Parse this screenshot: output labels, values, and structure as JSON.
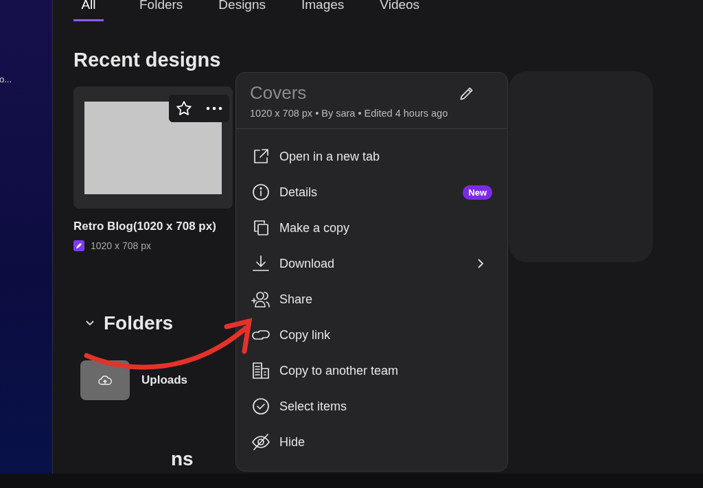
{
  "sidebar": {
    "items": [
      {
        "label": "o..."
      }
    ]
  },
  "tabs": [
    {
      "label": "All",
      "selected": true
    },
    {
      "label": "Folders",
      "selected": false
    },
    {
      "label": "Designs",
      "selected": false
    },
    {
      "label": "Images",
      "selected": false
    },
    {
      "label": "Videos",
      "selected": false
    }
  ],
  "recent": {
    "title": "Recent designs",
    "designs": [
      {
        "title": "Retro Blog(1020 x 708 px)",
        "size": "1020 x 708 px"
      }
    ]
  },
  "folders": {
    "title": "Folders",
    "expanded": true,
    "items": [
      {
        "name": "Uploads"
      }
    ]
  },
  "next_section": {
    "title": "ns"
  },
  "context_menu": {
    "title": "Covers",
    "meta": "1020 x 708 px • By sara • Edited 4 hours ago",
    "items": [
      {
        "kind": "open",
        "label": "Open in a new tab",
        "submenu": false
      },
      {
        "kind": "details",
        "label": "Details",
        "submenu": false,
        "badge": "New"
      },
      {
        "kind": "copy",
        "label": "Make a copy",
        "submenu": false
      },
      {
        "kind": "download",
        "label": "Download",
        "submenu": true
      },
      {
        "kind": "share",
        "label": "Share",
        "submenu": false
      },
      {
        "kind": "link",
        "label": "Copy link",
        "submenu": false
      },
      {
        "kind": "team",
        "label": "Copy to another team",
        "submenu": false
      },
      {
        "kind": "select",
        "label": "Select items",
        "submenu": false
      },
      {
        "kind": "hide",
        "label": "Hide",
        "submenu": false
      }
    ]
  }
}
